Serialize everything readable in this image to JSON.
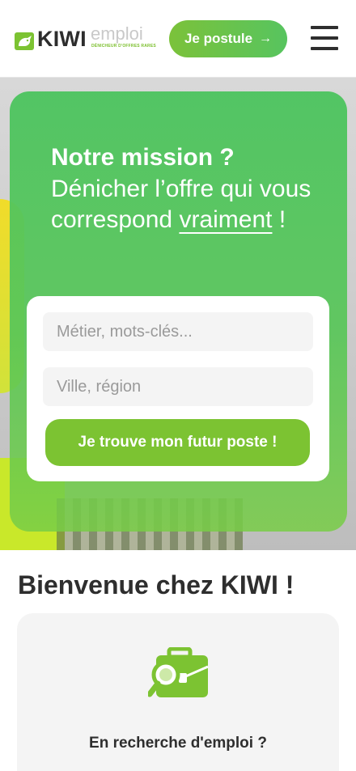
{
  "header": {
    "logo_kiwi": "KIWI",
    "logo_emploi": "emploi",
    "logo_tagline": "DÉNICHEUR D'OFFRES RARES",
    "apply_button": "Je postule",
    "apply_arrow": "→",
    "menu_icon": "hamburger-menu-icon"
  },
  "hero": {
    "title": "Notre mission ?",
    "text_part1": "Dénicher l’offre qui vous correspond ",
    "text_underlined": "vraiment",
    "text_part2": " !",
    "search": {
      "job_placeholder": "Métier, mots-clés...",
      "location_placeholder": "Ville, région",
      "submit_label": "Je trouve mon futur poste !"
    }
  },
  "welcome": {
    "title": "Bienvenue chez KIWI !",
    "card_icon": "briefcase-search-icon",
    "card_label": "En recherche d'emploi ?"
  },
  "colors": {
    "brand_green": "#7cc332",
    "hero_green": "#4ec460",
    "text_dark": "#2e2e2e"
  }
}
